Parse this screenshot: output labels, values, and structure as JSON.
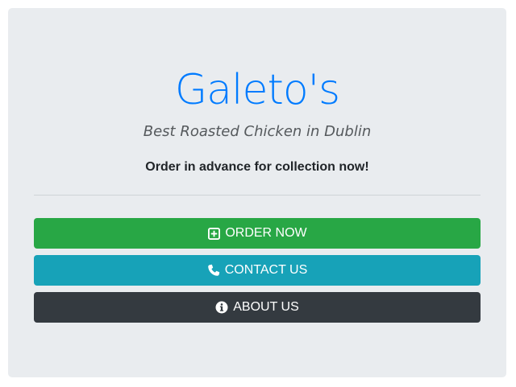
{
  "hero": {
    "title": "Galeto's",
    "subtitle": "Best Roasted Chicken in Dublin",
    "lead": "Order in advance for collection now!"
  },
  "buttons": [
    {
      "label": "ORDER NOW",
      "icon": "plus-square-icon",
      "color": "#28a745"
    },
    {
      "label": "CONTACT US",
      "icon": "phone-icon",
      "color": "#17a2b8"
    },
    {
      "label": "ABOUT US",
      "icon": "info-circle-icon",
      "color": "#343a40"
    }
  ],
  "theme": {
    "title_color": "#007bff",
    "background": "#e9ecef"
  }
}
